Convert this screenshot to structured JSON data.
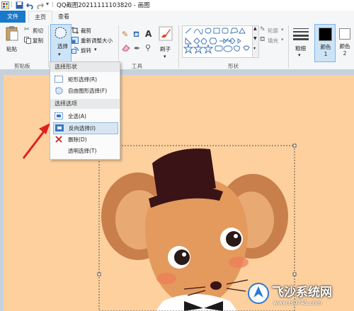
{
  "window": {
    "title": "QQ截图20211111103820 - 画图"
  },
  "tabs": {
    "file": "文件",
    "home": "主页",
    "view": "查看"
  },
  "clipboard": {
    "paste": "粘贴",
    "cut": "剪切",
    "copy": "复制",
    "group": "剪贴板"
  },
  "image": {
    "select": "选择",
    "crop": "裁剪",
    "resize": "重新调整大小",
    "rotate": "旋转"
  },
  "tools": {
    "group": "工具",
    "brushes": "刷子"
  },
  "shapes": {
    "group": "形状",
    "outline": "轮廓",
    "fill": "填充"
  },
  "size": {
    "label": "粗细"
  },
  "colors": {
    "color1": "颜色 1",
    "color2": "颜色 2",
    "color1_hex": "#000000",
    "color2_hex": "#ffffff"
  },
  "dropdown": {
    "section_shape": "选择形状",
    "rect": "矩形选择(R)",
    "freeform": "自由图形选择(F)",
    "section_options": "选择选项",
    "select_all": "全选(A)",
    "invert": "反向选择(I)",
    "delete": "删除(D)",
    "transparent": "透明选择(T)"
  },
  "watermark": {
    "text": "飞沙系统网",
    "url": "www.fs0745.com"
  },
  "accent": "#1979ca"
}
